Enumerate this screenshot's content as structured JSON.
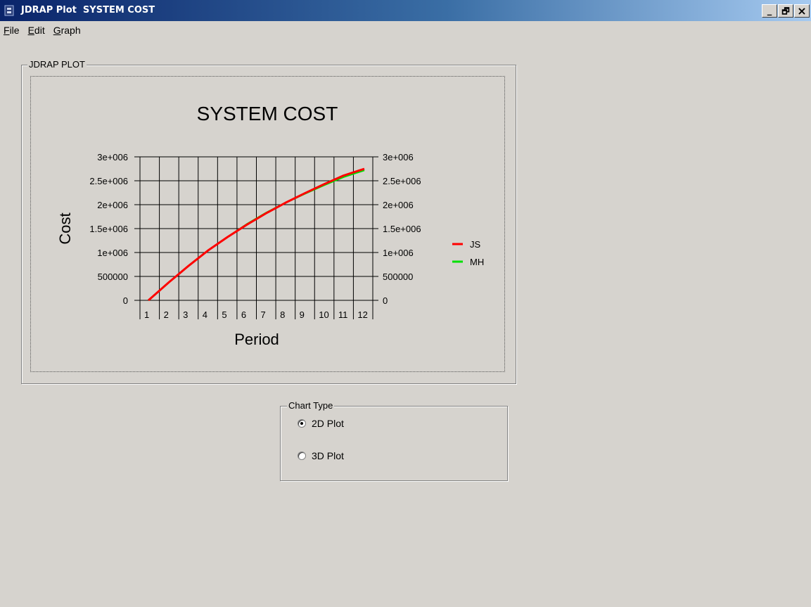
{
  "window": {
    "title": "JDRAP Plot  SYSTEM COST",
    "min_label": "_",
    "restore_label": "🗗",
    "close_label": "×"
  },
  "menu": [
    {
      "label": "File",
      "accel": "F"
    },
    {
      "label": "Edit",
      "accel": "E"
    },
    {
      "label": "Graph",
      "accel": "G"
    }
  ],
  "plot_group_label": "JDRAP PLOT",
  "chart_type": {
    "label": "Chart Type",
    "options": [
      {
        "label": "2D Plot",
        "selected": true
      },
      {
        "label": "3D Plot",
        "selected": false
      }
    ]
  },
  "chart_data": {
    "type": "line",
    "title": "SYSTEM COST",
    "xlabel": "Period",
    "ylabel": "Cost",
    "categories": [
      "1",
      "2",
      "3",
      "4",
      "5",
      "6",
      "7",
      "8",
      "9",
      "10",
      "11",
      "12"
    ],
    "ylim": [
      0,
      3000000
    ],
    "yticks": [
      0,
      500000,
      1000000,
      1500000,
      2000000,
      2500000,
      3000000
    ],
    "ytick_labels": [
      "0",
      "500000",
      "1e+006",
      "1.5e+006",
      "2e+006",
      "2.5e+006",
      "3e+006"
    ],
    "right_axis": true,
    "grid": true,
    "legend_position": "right",
    "series": [
      {
        "name": "JS",
        "color": "#ff0000",
        "values": [
          0,
          380000,
          720000,
          1040000,
          1320000,
          1580000,
          1820000,
          2040000,
          2240000,
          2430000,
          2610000,
          2750000
        ]
      },
      {
        "name": "MH",
        "color": "#00e000",
        "values": [
          0,
          380000,
          720000,
          1040000,
          1320000,
          1590000,
          1830000,
          2040000,
          2230000,
          2410000,
          2580000,
          2720000
        ]
      }
    ]
  },
  "colors": {
    "background": "#d6d3ce",
    "title_start": "#0a246a",
    "title_end": "#a6caf0"
  }
}
